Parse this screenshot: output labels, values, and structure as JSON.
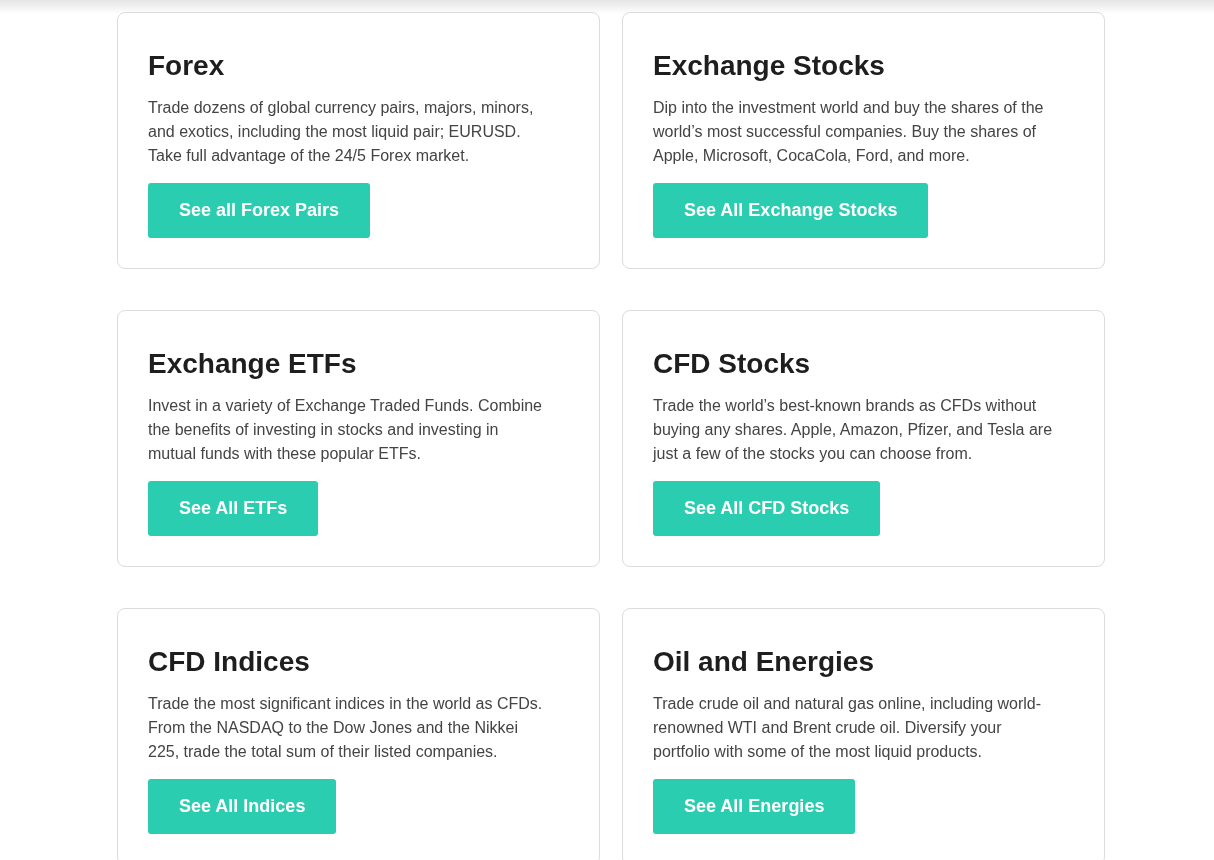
{
  "cards": [
    {
      "title": "Forex",
      "description": "Trade dozens of global currency pairs, majors, minors, and exotics, including the most liquid pair; EURUSD. Take full advantage of the 24/5 Forex market.",
      "button": "See all Forex Pairs"
    },
    {
      "title": "Exchange Stocks",
      "description": "Dip into the investment world and buy the shares of the world’s most successful companies. Buy the shares of Apple, Microsoft, CocaCola, Ford, and more.",
      "button": "See All Exchange Stocks"
    },
    {
      "title": "Exchange ETFs",
      "description": "Invest in a variety of Exchange Traded Funds. Combine the benefits of investing in stocks and investing in mutual funds with these popular ETFs.",
      "button": "See All ETFs"
    },
    {
      "title": "CFD Stocks",
      "description": "Trade the world’s best-known brands as CFDs without buying any shares. Apple, Amazon, Pfizer, and Tesla are just a few of the stocks you can choose from.",
      "button": "See All CFD Stocks"
    },
    {
      "title": "CFD Indices",
      "description": "Trade the most significant indices in the world as CFDs. From the NASDAQ to the Dow Jones and the Nikkei 225, trade the total sum of their listed companies.",
      "button": "See All Indices"
    },
    {
      "title": "Oil and Energies",
      "description": "Trade crude oil and natural gas online, including world-renowned WTI and Brent crude oil. Diversify your portfolio with some of the most liquid products.",
      "button": "See All Energies"
    }
  ]
}
